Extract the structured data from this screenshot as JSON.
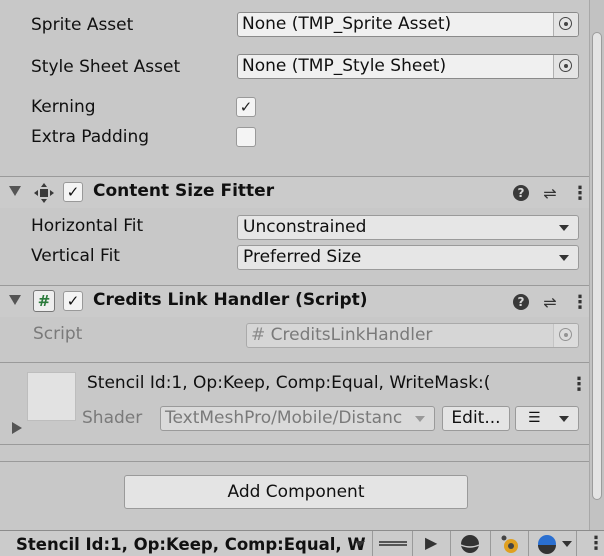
{
  "text_settings": {
    "sprite_asset_label": "Sprite Asset",
    "sprite_asset_value": "None (TMP_Sprite Asset)",
    "style_sheet_label": "Style Sheet Asset",
    "style_sheet_value": "None (TMP_Style Sheet)",
    "kerning_label": "Kerning",
    "kerning_checked": "✓",
    "extra_padding_label": "Extra Padding"
  },
  "content_size_fitter": {
    "title": "Content Size Fitter",
    "enabled_mark": "✓",
    "horizontal_fit_label": "Horizontal Fit",
    "horizontal_fit_value": "Unconstrained",
    "vertical_fit_label": "Vertical Fit",
    "vertical_fit_value": "Preferred Size"
  },
  "credits_link_handler": {
    "title": "Credits Link Handler (Script)",
    "enabled_mark": "✓",
    "script_label": "Script",
    "script_value": "CreditsLinkHandler",
    "script_icon": "#"
  },
  "material": {
    "name": "Stencil Id:1, Op:Keep, Comp:Equal, WriteMask:(",
    "shader_label": "Shader",
    "shader_value": "TextMeshPro/Mobile/Distanc",
    "edit_label": "Edit...",
    "list_icon": "☰"
  },
  "add_component_label": "Add Component",
  "bottom_bar": {
    "material_label": "Stencil Id:1, Op:Keep, Comp:Equal, W"
  },
  "icons": {
    "help": "?",
    "settings": "⇌",
    "more": "⋮",
    "play": "▶"
  }
}
